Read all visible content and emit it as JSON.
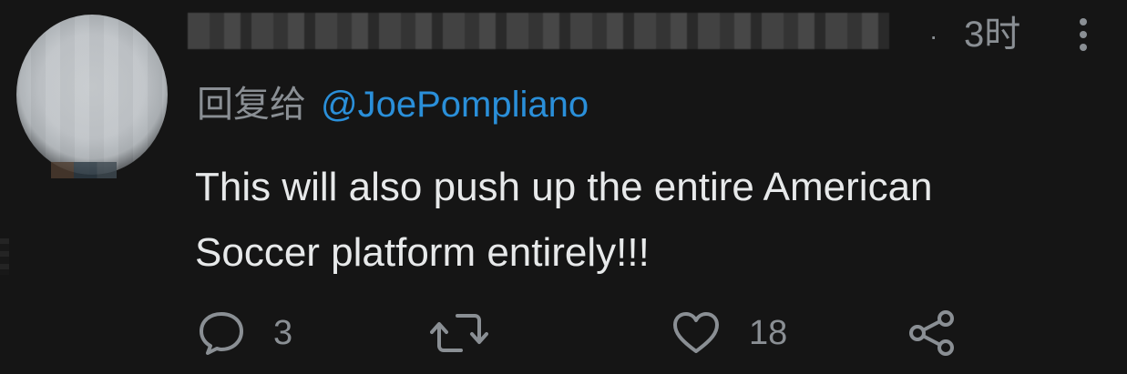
{
  "header": {
    "separator": "·",
    "time": "3时"
  },
  "reply": {
    "prefix": "回复给",
    "mention": "@JoePompliano"
  },
  "tweet": {
    "text_line1": "This will also push up the entire American",
    "text_line2": "Soccer platform entirely!!!"
  },
  "actions": {
    "reply_count": "3",
    "like_count": "18"
  },
  "icons": {
    "reply": "comment-bubble-icon",
    "retweet": "retweet-icon",
    "like": "heart-icon",
    "share": "share-icon",
    "more": "more-vertical-icon"
  },
  "colors": {
    "background": "#151515",
    "text": "#e7e9ea",
    "muted": "#8a8f94",
    "link": "#2a8fd9"
  }
}
